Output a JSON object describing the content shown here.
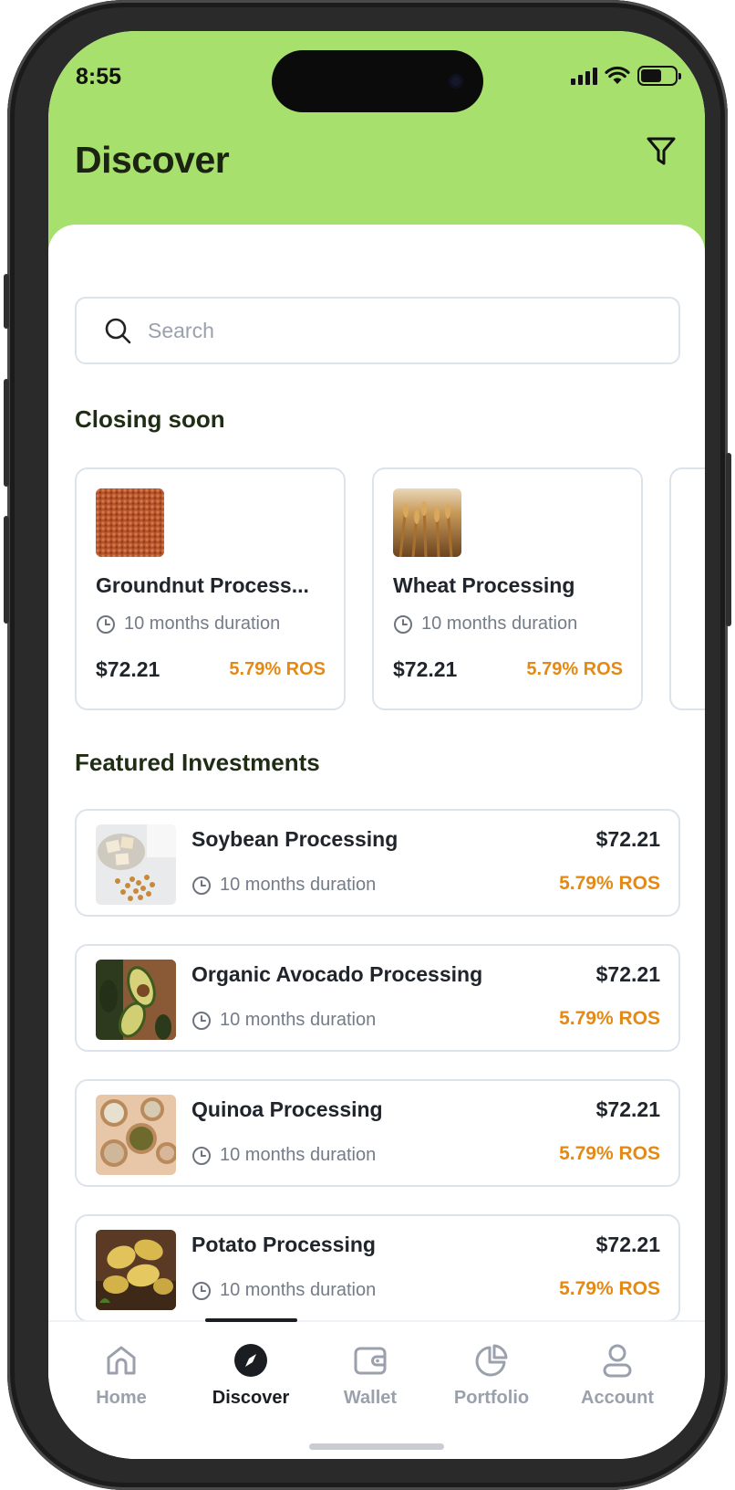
{
  "status_bar": {
    "time": "8:55"
  },
  "header": {
    "title": "Discover"
  },
  "search": {
    "placeholder": "Search"
  },
  "closing_soon": {
    "title": "Closing soon",
    "items": [
      {
        "name": "Groundnut Process...",
        "duration": "10 months duration",
        "price": "$72.21",
        "ros": "5.79% ROS",
        "image": "groundnut-image"
      },
      {
        "name": "Wheat Processing",
        "duration": "10 months duration",
        "price": "$72.21",
        "ros": "5.79% ROS",
        "image": "wheat-image"
      }
    ]
  },
  "featured": {
    "title": "Featured Investments",
    "items": [
      {
        "name": "Soybean Processing",
        "duration": "10 months duration",
        "price": "$72.21",
        "ros": "5.79% ROS",
        "image": "soybean-image"
      },
      {
        "name": "Organic Avocado Processing",
        "duration": "10 months duration",
        "price": "$72.21",
        "ros": "5.79% ROS",
        "image": "avocado-image"
      },
      {
        "name": "Quinoa Processing",
        "duration": "10 months duration",
        "price": "$72.21",
        "ros": "5.79% ROS",
        "image": "quinoa-image"
      },
      {
        "name": "Potato Processing",
        "duration": "10 months duration",
        "price": "$72.21",
        "ros": "5.79% ROS",
        "image": "potato-image"
      }
    ]
  },
  "nav": {
    "active": "Discover",
    "tabs": [
      {
        "label": "Home",
        "icon": "home-icon"
      },
      {
        "label": "Discover",
        "icon": "compass-icon"
      },
      {
        "label": "Wallet",
        "icon": "wallet-icon"
      },
      {
        "label": "Portfolio",
        "icon": "pie-chart-icon"
      },
      {
        "label": "Account",
        "icon": "user-icon"
      }
    ]
  },
  "colors": {
    "header_green": "#a8e06e",
    "ros_orange": "#e48a14",
    "text_dark": "#20242b",
    "muted": "#747c88"
  }
}
